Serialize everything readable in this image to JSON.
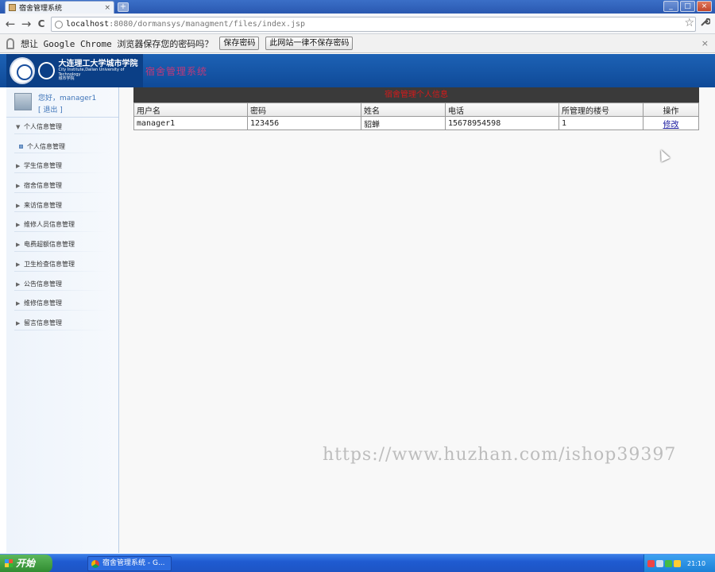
{
  "browser": {
    "tab_title": "宿舍管理系统",
    "tab_close": "×",
    "new_tab": "+",
    "window_buttons": [
      "_",
      "□",
      "×"
    ],
    "nav": {
      "back": "←",
      "forward": "→",
      "reload": "C"
    },
    "url": {
      "host": "localhost",
      "rest": ":8080/dormansys/managment/files/index.jsp"
    },
    "star": "☆",
    "wrench": "🔧",
    "infobar": {
      "message": "想让 Google Chrome 浏览器保存您的密码吗？",
      "save_button": "保存密码",
      "never_button": "此网站一律不保存密码",
      "close": "×"
    }
  },
  "header": {
    "logo_cn": "大连理工大学城市学院",
    "logo_en": "City Institute,Dalian University of Technology",
    "logo_sub": "城市学院",
    "system_title": "宿舍管理系统"
  },
  "sidebar": {
    "greeting": "您好，manager1",
    "logout": "[ 退出 ]",
    "items": [
      {
        "label": "个人信息管理",
        "arrow": "▼"
      },
      {
        "label": "个人信息管理",
        "sub": true
      },
      {
        "label": "学生信息管理",
        "arrow": "▶"
      },
      {
        "label": "宿舍信息管理",
        "arrow": "▶"
      },
      {
        "label": "来访信息管理",
        "arrow": "▶"
      },
      {
        "label": "维修人员信息管理",
        "arrow": "▶"
      },
      {
        "label": "电费超额信息管理",
        "arrow": "▶"
      },
      {
        "label": "卫生检查信息管理",
        "arrow": "▶"
      },
      {
        "label": "公告信息管理",
        "arrow": "▶"
      },
      {
        "label": "维修信息管理",
        "arrow": "▶"
      },
      {
        "label": "留言信息管理",
        "arrow": "▶"
      }
    ]
  },
  "main": {
    "panel_title": "宿舍管理个人信息",
    "columns": [
      "用户名",
      "密码",
      "姓名",
      "电话",
      "所管理的楼号",
      "操作"
    ],
    "rows": [
      {
        "username": "manager1",
        "password": "123456",
        "name": "貂蝉",
        "phone": "15678954598",
        "building": "1",
        "action": "修改"
      }
    ]
  },
  "watermark": "https://www.huzhan.com/ishop39397",
  "taskbar": {
    "start": "开始",
    "task": "宿舍管理系统 - G...",
    "clock": "21:10"
  },
  "colors": {
    "header_blue": "#1d62b5",
    "title_pink": "#c0397a",
    "panel_title_red": "#d41a1a",
    "panel_bg": "#3a3a3a"
  }
}
